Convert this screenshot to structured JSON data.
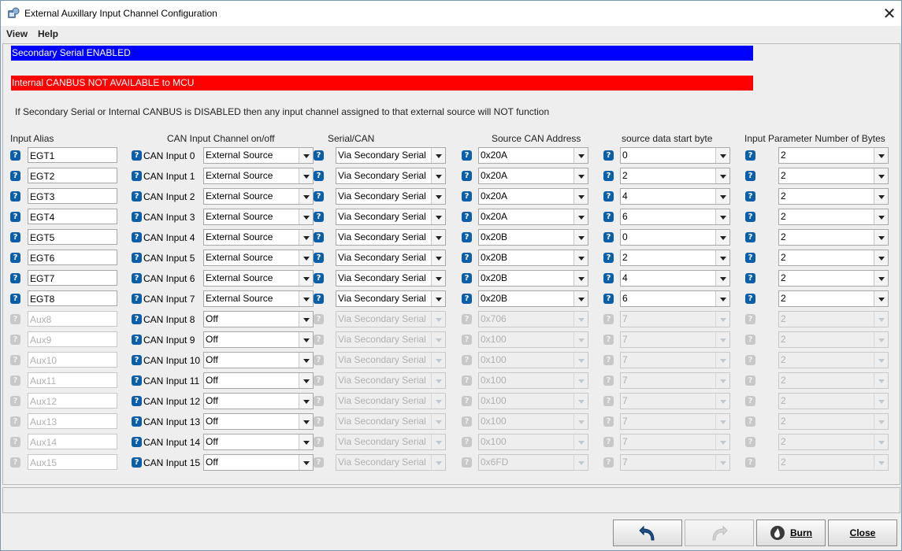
{
  "window": {
    "title": "External Auxillary Input Channel Configuration",
    "close_symbol": "✕"
  },
  "menu": {
    "view": "View",
    "help": "Help"
  },
  "banners": {
    "serial": "Secondary Serial ENABLED",
    "canbus": "Internal CANBUS NOT AVAILABLE to MCU",
    "note": "If Secondary Serial or Internal CANBUS is DISABLED then any input channel assigned to that external source will NOT function"
  },
  "headers": {
    "alias": "Input Alias",
    "channel": "CAN Input Channel on/off",
    "serial_can": "Serial/CAN",
    "address": "Source CAN Address",
    "start_byte": "source data start byte",
    "num_bytes": "Input Parameter Number of Bytes"
  },
  "help_glyph": "?",
  "rows": [
    {
      "alias": "EGT1",
      "label": "CAN Input 0",
      "onoff": "External Source",
      "serial": "Via Secondary Serial",
      "addr": "0x20A",
      "start": "0",
      "bytes": "2",
      "enabled": true
    },
    {
      "alias": "EGT2",
      "label": "CAN Input 1",
      "onoff": "External Source",
      "serial": "Via Secondary Serial",
      "addr": "0x20A",
      "start": "2",
      "bytes": "2",
      "enabled": true
    },
    {
      "alias": "EGT3",
      "label": "CAN Input 2",
      "onoff": "External Source",
      "serial": "Via Secondary Serial",
      "addr": "0x20A",
      "start": "4",
      "bytes": "2",
      "enabled": true
    },
    {
      "alias": "EGT4",
      "label": "CAN Input 3",
      "onoff": "External Source",
      "serial": "Via Secondary Serial",
      "addr": "0x20A",
      "start": "6",
      "bytes": "2",
      "enabled": true
    },
    {
      "alias": "EGT5",
      "label": "CAN Input 4",
      "onoff": "External Source",
      "serial": "Via Secondary Serial",
      "addr": "0x20B",
      "start": "0",
      "bytes": "2",
      "enabled": true
    },
    {
      "alias": "EGT6",
      "label": "CAN Input 5",
      "onoff": "External Source",
      "serial": "Via Secondary Serial",
      "addr": "0x20B",
      "start": "2",
      "bytes": "2",
      "enabled": true
    },
    {
      "alias": "EGT7",
      "label": "CAN Input 6",
      "onoff": "External Source",
      "serial": "Via Secondary Serial",
      "addr": "0x20B",
      "start": "4",
      "bytes": "2",
      "enabled": true
    },
    {
      "alias": "EGT8",
      "label": "CAN Input 7",
      "onoff": "External Source",
      "serial": "Via Secondary Serial",
      "addr": "0x20B",
      "start": "6",
      "bytes": "2",
      "enabled": true
    },
    {
      "alias": "Aux8",
      "label": "CAN Input 8",
      "onoff": "Off",
      "serial": "Via Secondary Serial",
      "addr": "0x706",
      "start": "7",
      "bytes": "2",
      "enabled": false
    },
    {
      "alias": "Aux9",
      "label": "CAN Input 9",
      "onoff": "Off",
      "serial": "Via Secondary Serial",
      "addr": "0x100",
      "start": "7",
      "bytes": "2",
      "enabled": false
    },
    {
      "alias": "Aux10",
      "label": "CAN Input 10",
      "onoff": "Off",
      "serial": "Via Secondary Serial",
      "addr": "0x100",
      "start": "7",
      "bytes": "2",
      "enabled": false
    },
    {
      "alias": "Aux11",
      "label": "CAN Input 11",
      "onoff": "Off",
      "serial": "Via Secondary Serial",
      "addr": "0x100",
      "start": "7",
      "bytes": "2",
      "enabled": false
    },
    {
      "alias": "Aux12",
      "label": "CAN Input 12",
      "onoff": "Off",
      "serial": "Via Secondary Serial",
      "addr": "0x100",
      "start": "7",
      "bytes": "2",
      "enabled": false
    },
    {
      "alias": "Aux13",
      "label": "CAN Input 13",
      "onoff": "Off",
      "serial": "Via Secondary Serial",
      "addr": "0x100",
      "start": "7",
      "bytes": "2",
      "enabled": false
    },
    {
      "alias": "Aux14",
      "label": "CAN Input 14",
      "onoff": "Off",
      "serial": "Via Secondary Serial",
      "addr": "0x100",
      "start": "7",
      "bytes": "2",
      "enabled": false
    },
    {
      "alias": "Aux15",
      "label": "CAN Input 15",
      "onoff": "Off",
      "serial": "Via Secondary Serial",
      "addr": "0x6FD",
      "start": "7",
      "bytes": "2",
      "enabled": false
    }
  ],
  "buttons": {
    "burn": "Burn",
    "close": "Close"
  },
  "icons": {
    "app": "app-icon",
    "undo": "undo-icon",
    "redo": "redo-icon",
    "burn": "burn-icon",
    "help": "help-icon"
  }
}
